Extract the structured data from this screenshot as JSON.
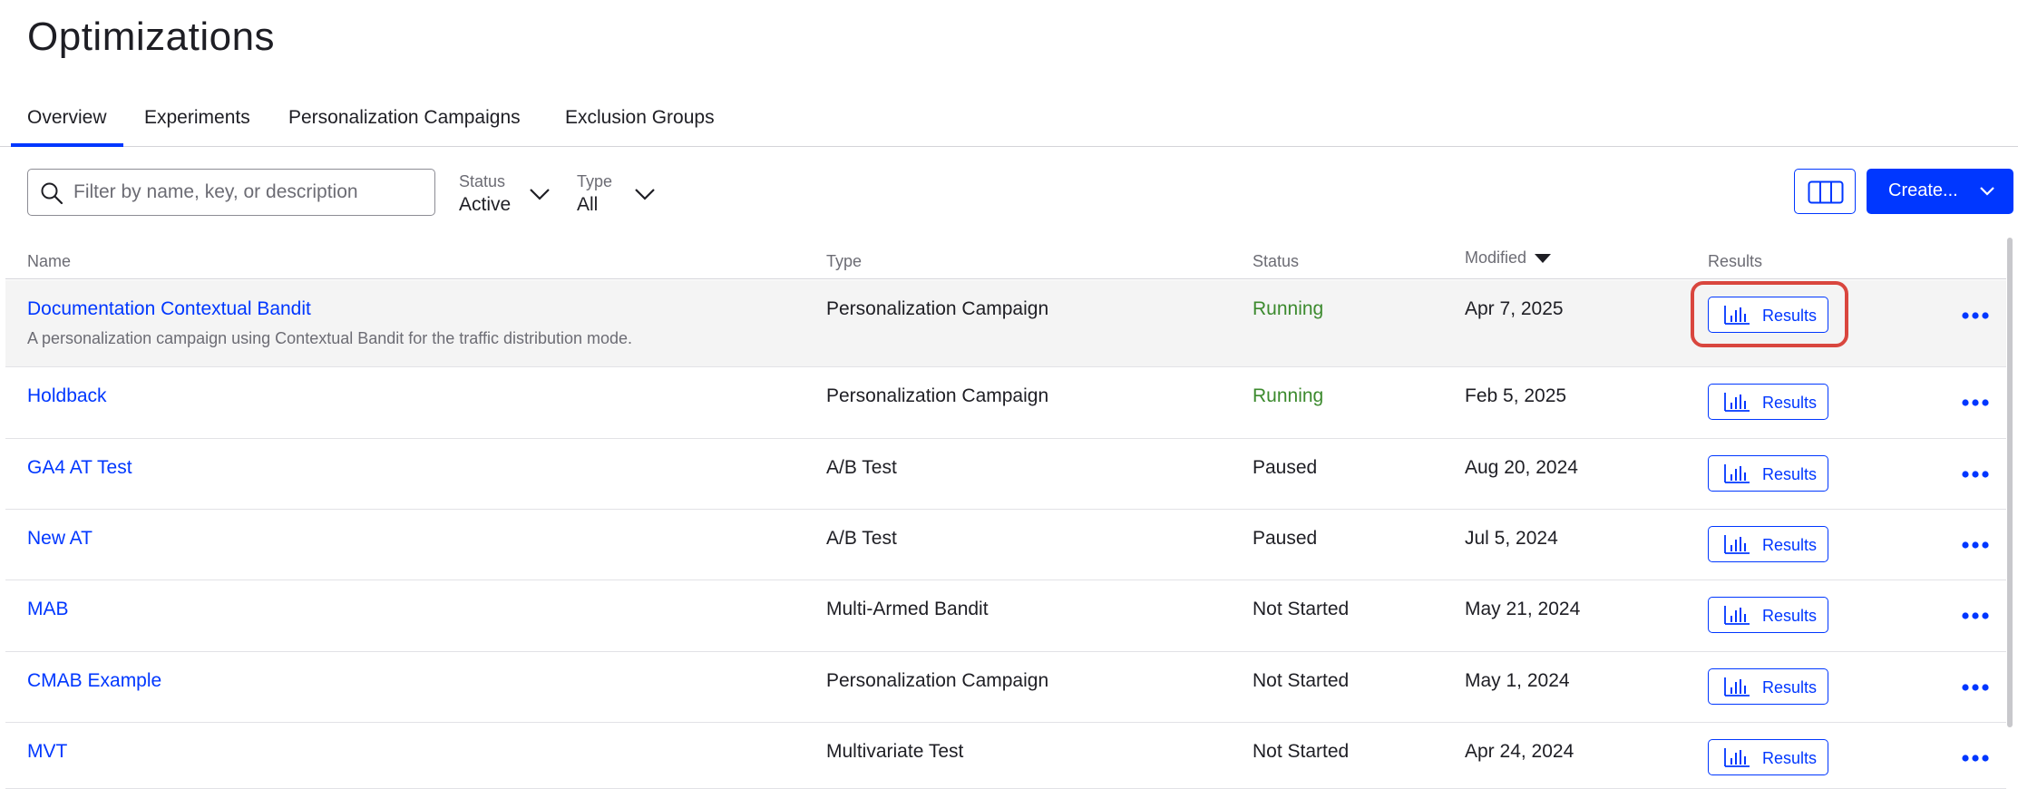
{
  "page": {
    "title": "Optimizations"
  },
  "tabs": [
    {
      "label": "Overview",
      "active": true
    },
    {
      "label": "Experiments",
      "active": false
    },
    {
      "label": "Personalization Campaigns",
      "active": false
    },
    {
      "label": "Exclusion Groups",
      "active": false
    }
  ],
  "toolbar": {
    "search_placeholder": "Filter by name, key, or description",
    "search_value": "",
    "status_filter": {
      "label": "Status",
      "value": "Active"
    },
    "type_filter": {
      "label": "Type",
      "value": "All"
    },
    "create_label": "Create..."
  },
  "table": {
    "columns": {
      "name": "Name",
      "type": "Type",
      "status": "Status",
      "modified": "Modified",
      "results": "Results"
    },
    "sort": {
      "column": "Modified",
      "direction": "descending"
    },
    "rows": [
      {
        "name": "Documentation Contextual Bandit",
        "description": "A personalization campaign using Contextual Bandit for the traffic distribution mode.",
        "type": "Personalization Campaign",
        "status": "Running",
        "modified": "Apr 7, 2025",
        "results_label": "Results"
      },
      {
        "name": "Holdback",
        "description": "",
        "type": "Personalization Campaign",
        "status": "Running",
        "modified": "Feb 5, 2025",
        "results_label": "Results"
      },
      {
        "name": "GA4 AT Test",
        "description": "",
        "type": "A/B Test",
        "status": "Paused",
        "modified": "Aug 20, 2024",
        "results_label": "Results"
      },
      {
        "name": "New AT",
        "description": "",
        "type": "A/B Test",
        "status": "Paused",
        "modified": "Jul 5, 2024",
        "results_label": "Results"
      },
      {
        "name": "MAB",
        "description": "",
        "type": "Multi-Armed Bandit",
        "status": "Not Started",
        "modified": "May 21, 2024",
        "results_label": "Results"
      },
      {
        "name": "CMAB Example",
        "description": "",
        "type": "Personalization Campaign",
        "status": "Not Started",
        "modified": "May 1, 2024",
        "results_label": "Results"
      },
      {
        "name": "MVT",
        "description": "",
        "type": "Multivariate Test",
        "status": "Not Started",
        "modified": "Apr 24, 2024",
        "results_label": "Results"
      }
    ]
  },
  "colors": {
    "accent": "#0037ff",
    "running": "#3c8a2e",
    "highlight_ring": "#d9463e",
    "selected_row": "#f4f4f4"
  },
  "icons": {
    "search": "search-icon",
    "chevron": "chevron-down-icon",
    "columns": "columns-icon",
    "results": "bar-chart-icon",
    "more": "more-horizontal-icon",
    "sort": "sort-descending-icon"
  }
}
